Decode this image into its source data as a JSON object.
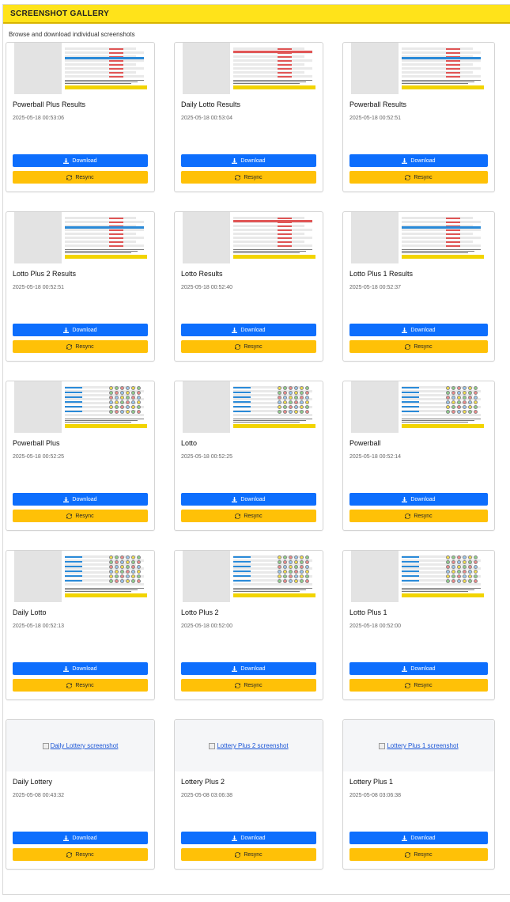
{
  "gallery": {
    "title": "SCREENSHOT GALLERY",
    "subtitle": "Browse and download individual screenshots",
    "download_label": "Download",
    "resync_label": "Resync"
  },
  "cards": [
    {
      "title": "Powerball Plus Results",
      "date": "2025-05-18 00:53:06"
    },
    {
      "title": "Daily Lotto Results",
      "date": "2025-05-18 00:53:04"
    },
    {
      "title": "Powerball Results",
      "date": "2025-05-18 00:52:51"
    },
    {
      "title": "Lotto Plus 2 Results",
      "date": "2025-05-18 00:52:51"
    },
    {
      "title": "Lotto Results",
      "date": "2025-05-18 00:52:40"
    },
    {
      "title": "Lotto Plus 1 Results",
      "date": "2025-05-18 00:52:37"
    },
    {
      "title": "Powerball Plus",
      "date": "2025-05-18 00:52:25"
    },
    {
      "title": "Lotto",
      "date": "2025-05-18 00:52:25"
    },
    {
      "title": "Powerball",
      "date": "2025-05-18 00:52:14"
    },
    {
      "title": "Daily Lotto",
      "date": "2025-05-18 00:52:13"
    },
    {
      "title": "Lotto Plus 2",
      "date": "2025-05-18 00:52:00"
    },
    {
      "title": "Lotto Plus 1",
      "date": "2025-05-18 00:52:00"
    },
    {
      "title": "Daily Lottery",
      "date": "2025-05-08 00:43:32",
      "broken_alt": "Daily Lottery screenshot"
    },
    {
      "title": "Lottery Plus 2",
      "date": "2025-05-08 03:06:38",
      "broken_alt": "Lottery Plus 2 screenshot"
    },
    {
      "title": "Lottery Plus 1",
      "date": "2025-05-08 03:06:38",
      "broken_alt": "Lottery Plus 1 screenshot"
    }
  ],
  "icons": {
    "download": "download-icon",
    "resync": "sync-icon"
  },
  "colors": {
    "header": "#ffe31a",
    "download": "#0d6efd",
    "resync": "#ffc107"
  }
}
